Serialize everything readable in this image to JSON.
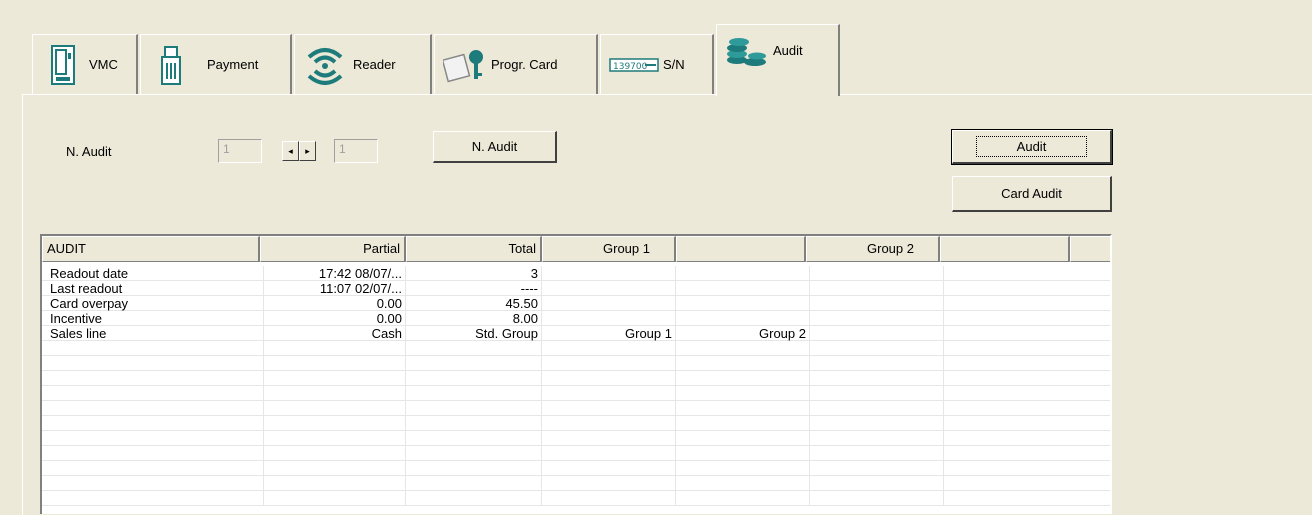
{
  "tabs": [
    {
      "label": "VMC",
      "icon": "vending-machine-icon",
      "active": false
    },
    {
      "label": "Payment",
      "icon": "coin-mech-icon",
      "active": false
    },
    {
      "label": "Reader",
      "icon": "wireless-reader-icon",
      "active": false
    },
    {
      "label": "Progr. Card",
      "icon": "card-key-icon",
      "active": false
    },
    {
      "label": "S/N",
      "icon": "serial-number-icon",
      "active": false
    },
    {
      "label": "Audit",
      "icon": "coins-stack-icon",
      "active": true
    }
  ],
  "audit_form": {
    "label": "N. Audit",
    "from_value": "1",
    "to_value": "1",
    "spin_left": "◂",
    "spin_right": "▸",
    "n_audit_button": "N. Audit",
    "audit_button": "Audit",
    "card_audit_button": "Card Audit"
  },
  "table": {
    "headers": [
      "AUDIT",
      "Partial",
      "Total",
      "Group 1",
      "",
      "Group 2",
      "",
      ""
    ],
    "rows": [
      [
        "Readout date",
        "17:42 08/07/...",
        "3",
        "",
        "",
        "",
        ""
      ],
      [
        "Last readout",
        "11:07 02/07/...",
        "----",
        "",
        "",
        "",
        ""
      ],
      [
        "Card overpay",
        "0.00",
        "45.50",
        "",
        "",
        "",
        ""
      ],
      [
        "Incentive",
        "0.00",
        "8.00",
        "",
        "",
        "",
        ""
      ],
      [
        "Sales line",
        "Cash",
        "Std. Group",
        "Group 1",
        "Group 2",
        "",
        ""
      ],
      [
        "",
        "",
        "",
        "",
        "",
        "",
        ""
      ],
      [
        "",
        "",
        "",
        "",
        "",
        "",
        ""
      ],
      [
        "",
        "",
        "",
        "",
        "",
        "",
        ""
      ],
      [
        "",
        "",
        "",
        "",
        "",
        "",
        ""
      ],
      [
        "",
        "",
        "",
        "",
        "",
        "",
        ""
      ],
      [
        "",
        "",
        "",
        "",
        "",
        "",
        ""
      ],
      [
        "",
        "",
        "",
        "",
        "",
        "",
        ""
      ],
      [
        "",
        "",
        "",
        "",
        "",
        "",
        ""
      ],
      [
        "",
        "",
        "",
        "",
        "",
        "",
        ""
      ],
      [
        "",
        "",
        "",
        "",
        "",
        "",
        ""
      ],
      [
        "",
        "",
        "",
        "",
        "",
        "",
        ""
      ]
    ]
  },
  "colors": {
    "window_bg": "#ece9d8",
    "icon_teal": "#1e7b7b"
  }
}
